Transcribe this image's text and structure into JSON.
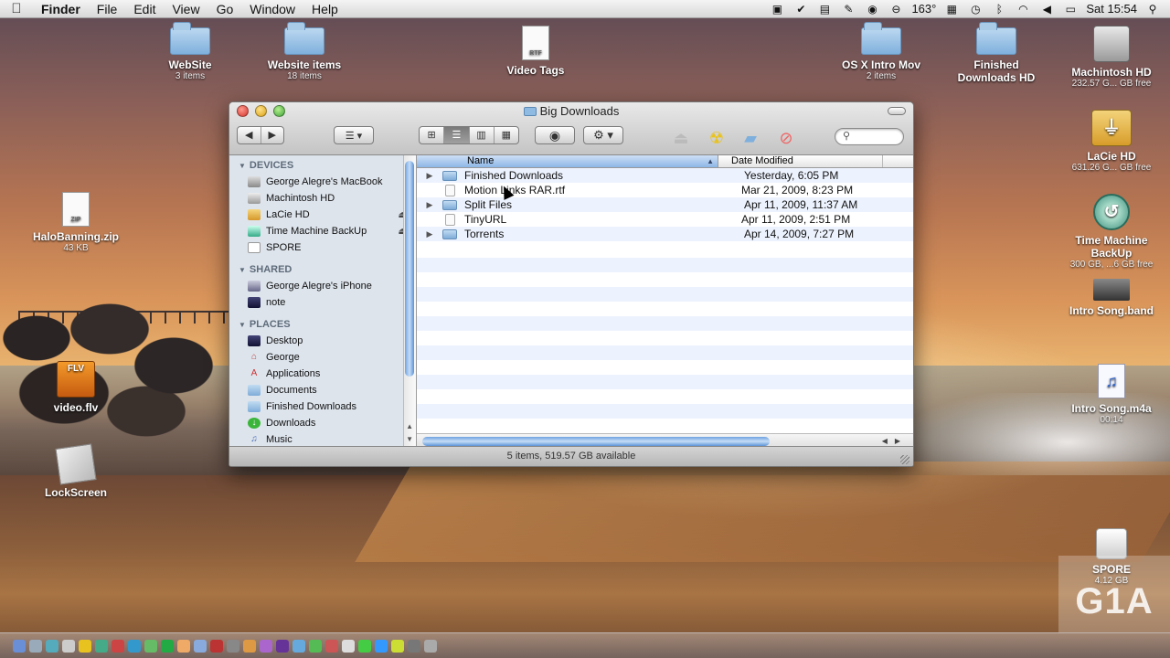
{
  "menubar": {
    "apple": "",
    "items": [
      "Finder",
      "File",
      "Edit",
      "View",
      "Go",
      "Window",
      "Help"
    ],
    "temperature": "163°",
    "clock": "Sat 15:54"
  },
  "desktop": {
    "icons": [
      {
        "label": "WebSite",
        "sub": "3 items"
      },
      {
        "label": "Website items",
        "sub": "18 items"
      },
      {
        "label": "Video Tags",
        "sub": "",
        "badge": "RTF"
      },
      {
        "label": "OS X Intro Mov",
        "sub": "2 items"
      },
      {
        "label": "Finished Downloads HD",
        "sub": ""
      },
      {
        "label": "Machintosh HD",
        "sub": "232.57 G... GB free"
      },
      {
        "label": "LaCie HD",
        "sub": "631.26 G... GB free"
      },
      {
        "label": "Time Machine BackUp",
        "sub": "300 GB, ...6 GB free"
      },
      {
        "label": "Intro Song.band",
        "sub": ""
      },
      {
        "label": "Intro Song.m4a",
        "sub": "00:14"
      },
      {
        "label": "HaloBanning.zip",
        "sub": "43 KB",
        "badge": "ZIP"
      },
      {
        "label": "video.flv",
        "sub": "",
        "badge": "FLV"
      },
      {
        "label": "LockScreen",
        "sub": ""
      },
      {
        "label": "SPORE",
        "sub": "4.12 GB"
      }
    ]
  },
  "window": {
    "title": "Big Downloads",
    "view_modes": [
      "⊞",
      "☰",
      "▥",
      "▦"
    ],
    "active_view": 1,
    "sidebar": {
      "devices_header": "DEVICES",
      "devices": [
        "George Alegre's MacBook",
        "Machintosh HD",
        "LaCie HD",
        "Time Machine BackUp",
        "SPORE"
      ],
      "shared_header": "SHARED",
      "shared": [
        "George Alegre's iPhone",
        "note"
      ],
      "places_header": "PLACES",
      "places": [
        "Desktop",
        "George",
        "Applications",
        "Documents",
        "Finished Downloads",
        "Downloads",
        "Music"
      ]
    },
    "columns": {
      "name": "Name",
      "date": "Date Modified"
    },
    "files": [
      {
        "name": "Finished Downloads",
        "date": "Yesterday, 6:05 PM",
        "kind": "folder"
      },
      {
        "name": "Motion Links RAR.rtf",
        "date": "Mar 21, 2009, 8:23 PM",
        "kind": "doc"
      },
      {
        "name": "Split Files",
        "date": "Apr 11, 2009, 11:37 AM",
        "kind": "folder"
      },
      {
        "name": "TinyURL",
        "date": "Apr 11, 2009, 2:51 PM",
        "kind": "doc"
      },
      {
        "name": "Torrents",
        "date": "Apr 14, 2009, 7:27 PM",
        "kind": "folder"
      }
    ],
    "status": "5 items, 519.57 GB available"
  },
  "watermark": "G1A"
}
